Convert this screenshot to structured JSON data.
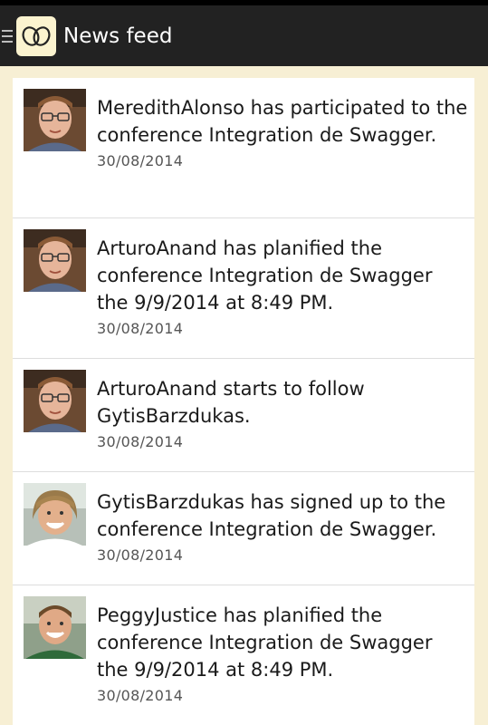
{
  "action_bar": {
    "title": "News feed",
    "menu_icon": "hamburger-menu-icon",
    "logo_icon": "app-logo-icon"
  },
  "colors": {
    "action_bar_bg": "#222222",
    "page_bg": "#f7efd4",
    "card_bg": "#ffffff",
    "logo_bg": "#fbf3cf"
  },
  "feed": [
    {
      "avatar_icon": "user-avatar-glasses-man",
      "message": "MeredithAlonso has participated to the conference Integration de Swagger.",
      "date": "30/08/2014"
    },
    {
      "avatar_icon": "user-avatar-glasses-man",
      "message": "ArturoAnand has planified the conference Integration de Swagger the 9/9/2014 at 8:49 PM.",
      "date": "30/08/2014"
    },
    {
      "avatar_icon": "user-avatar-glasses-man",
      "message": "ArturoAnand starts to follow GytisBarzdukas.",
      "date": "30/08/2014"
    },
    {
      "avatar_icon": "user-avatar-woman",
      "message": "GytisBarzdukas has signed up to the conference Integration de Swagger.",
      "date": "30/08/2014"
    },
    {
      "avatar_icon": "user-avatar-man-green-shirt",
      "message": "PeggyJustice has planified the conference Integration de Swagger the 9/9/2014 at 8:49 PM.",
      "date": "30/08/2014"
    }
  ]
}
